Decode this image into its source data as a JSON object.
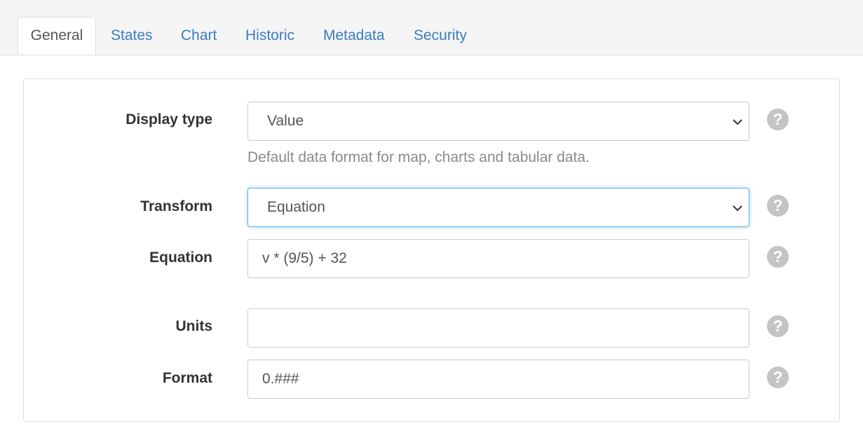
{
  "tabs": [
    {
      "label": "General",
      "active": true
    },
    {
      "label": "States",
      "active": false
    },
    {
      "label": "Chart",
      "active": false
    },
    {
      "label": "Historic",
      "active": false
    },
    {
      "label": "Metadata",
      "active": false
    },
    {
      "label": "Security",
      "active": false
    }
  ],
  "form": {
    "display_type": {
      "label": "Display type",
      "value": "Value",
      "help": "Default data format for map, charts and tabular data."
    },
    "transform": {
      "label": "Transform",
      "value": "Equation"
    },
    "equation": {
      "label": "Equation",
      "value": "v * (9/5) + 32"
    },
    "units": {
      "label": "Units",
      "value": ""
    },
    "format": {
      "label": "Format",
      "value": "0.###"
    }
  },
  "help_icon_glyph": "?",
  "colors": {
    "link": "#3a7cc0",
    "focus_border": "#66afe9",
    "help_icon": "#c4c4c4"
  }
}
